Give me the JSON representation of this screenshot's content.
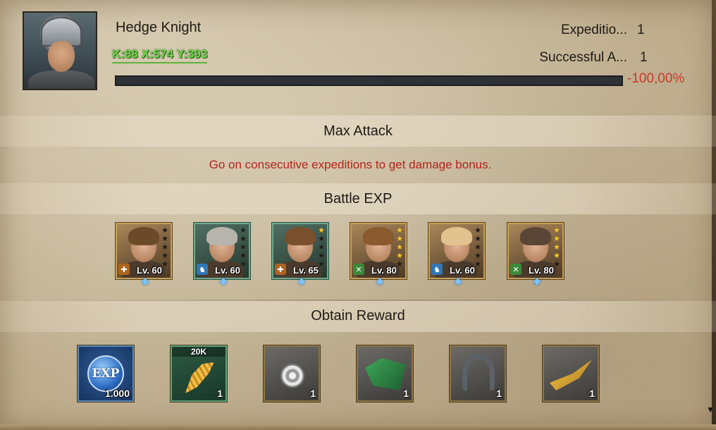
{
  "header": {
    "hero_name": "Hedge Knight",
    "coordinates": "K:88 X:574 Y:393",
    "stats": [
      {
        "label": "Expeditio...",
        "value": "1"
      },
      {
        "label": "Successful A...",
        "value": "1"
      }
    ],
    "progress_percent_label": "-100,00%",
    "progress_fill_fraction": 0
  },
  "sections": {
    "max_attack": "Max Attack",
    "bonus_message": "Go on consecutive expeditions to get damage bonus.",
    "battle_exp": "Battle EXP",
    "obtain_reward": "Obtain Reward"
  },
  "heroes": [
    {
      "level": "Lv. 60",
      "stars": 0,
      "class_icon": "sword-cross-icon",
      "frame": "gold",
      "hair_color": "#6b4a2a",
      "class_color": "#b0631f"
    },
    {
      "level": "Lv. 60",
      "stars": 0,
      "class_icon": "horse-icon",
      "frame": "green",
      "hair_color": "#b7b3ad",
      "class_color": "#2f77b7"
    },
    {
      "level": "Lv. 65",
      "stars": 1,
      "class_icon": "sword-cross-icon",
      "frame": "green",
      "hair_color": "#7a4f2c",
      "class_color": "#b0631f"
    },
    {
      "level": "Lv. 80",
      "stars": 4,
      "class_icon": "crossed-spears-icon",
      "frame": "gold",
      "hair_color": "#8a5a2e",
      "class_color": "#3d8a3a"
    },
    {
      "level": "Lv. 60",
      "stars": 0,
      "class_icon": "horse-icon",
      "frame": "gold",
      "hair_color": "#e2c38f",
      "class_color": "#2f77b7"
    },
    {
      "level": "Lv. 80",
      "stars": 4,
      "class_icon": "crossed-spears-icon",
      "frame": "gold",
      "hair_color": "#5a4636",
      "class_color": "#3d8a3a"
    }
  ],
  "rewards": [
    {
      "name": "exp-reward",
      "label": "EXP",
      "count": "1.000",
      "tag": "",
      "icon": "exp-icon"
    },
    {
      "name": "wheat-reward",
      "label": "",
      "count": "1",
      "tag": "20K",
      "icon": "wheat-icon"
    },
    {
      "name": "rose-reward",
      "label": "",
      "count": "1",
      "tag": "",
      "icon": "rose-icon"
    },
    {
      "name": "cloth-reward",
      "label": "",
      "count": "1",
      "tag": "",
      "icon": "cloth-icon"
    },
    {
      "name": "horseshoe-reward",
      "label": "",
      "count": "1",
      "tag": "",
      "icon": "horseshoe-icon"
    },
    {
      "name": "quill-reward",
      "label": "",
      "count": "1",
      "tag": "",
      "icon": "quill-icon"
    }
  ],
  "colors": {
    "coords": "#6fd54a",
    "negative": "#c93a2a",
    "bonus_text": "#b5241c",
    "star_on": "#f2c738"
  }
}
